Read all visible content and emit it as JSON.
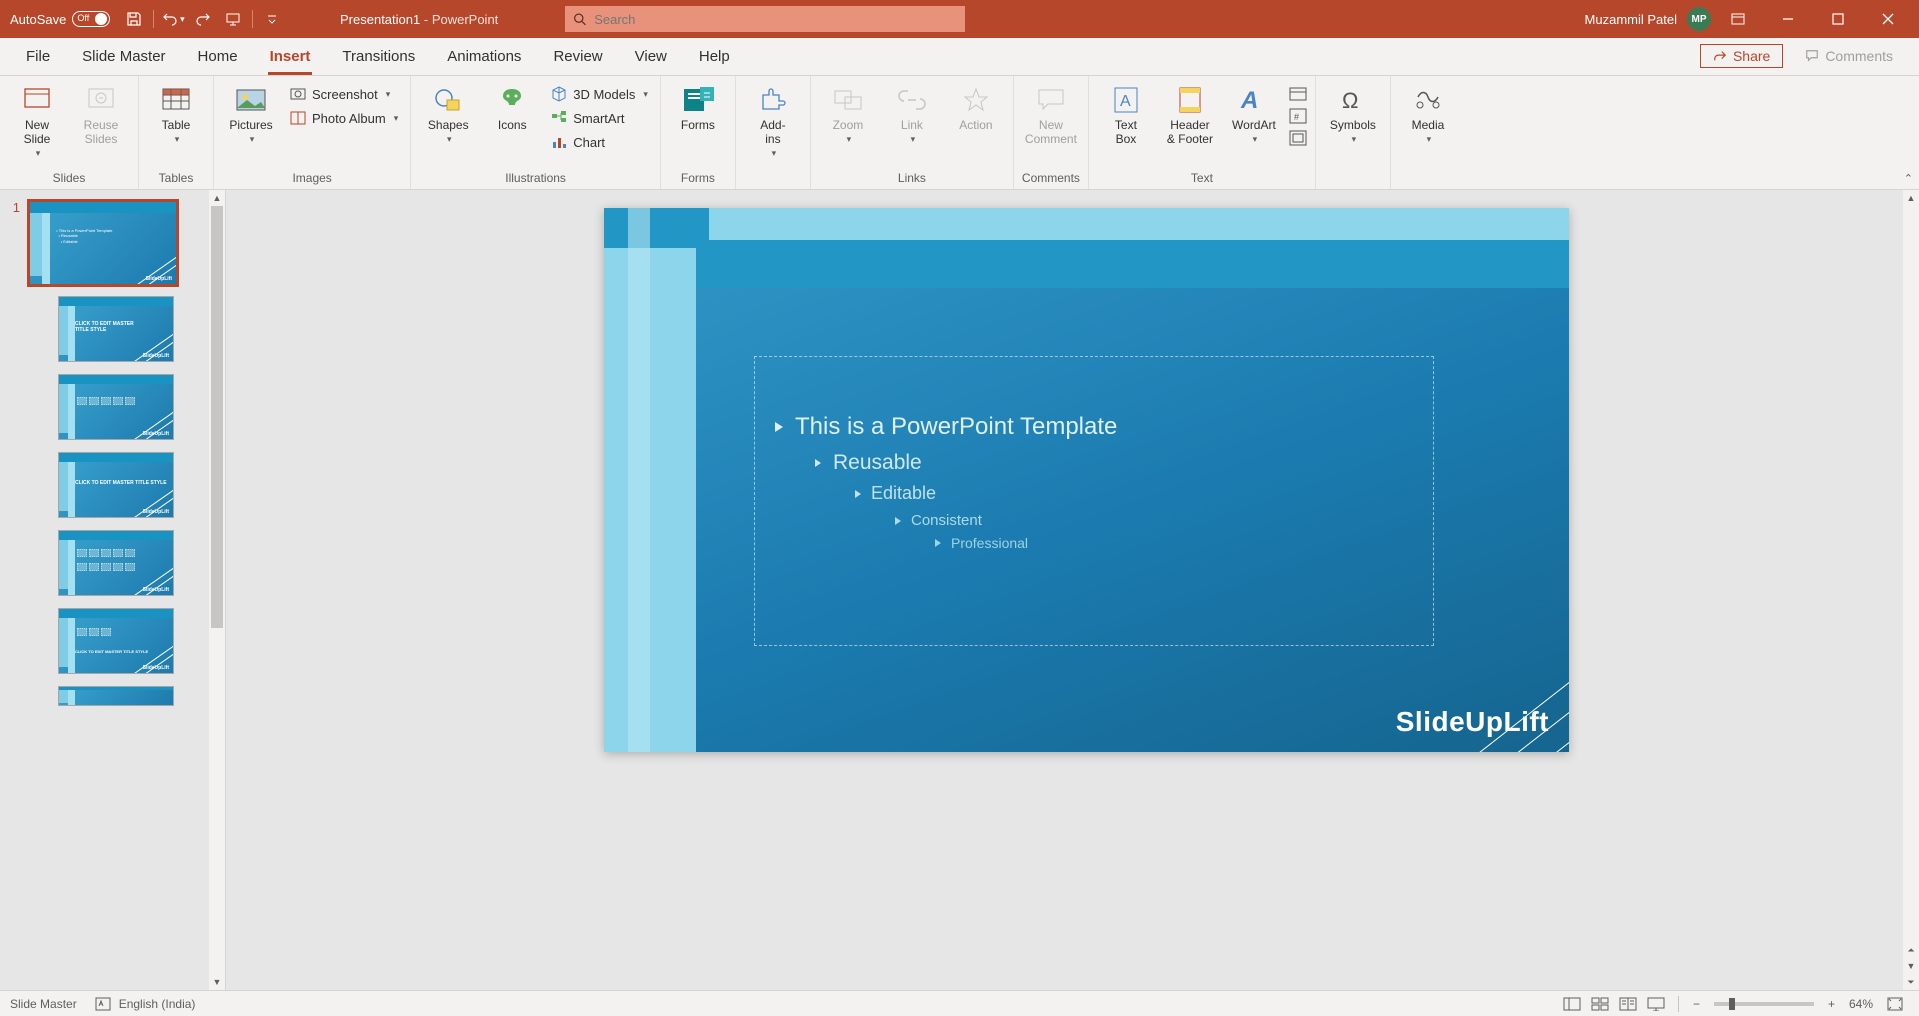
{
  "titlebar": {
    "autosave_label": "AutoSave",
    "autosave_state": "Off",
    "doc_name": "Presentation1",
    "app_name": "PowerPoint",
    "search_placeholder": "Search",
    "user_name": "Muzammil Patel",
    "user_initials": "MP"
  },
  "tabs": {
    "file": "File",
    "slide_master": "Slide Master",
    "home": "Home",
    "insert": "Insert",
    "transitions": "Transitions",
    "animations": "Animations",
    "review": "Review",
    "view": "View",
    "help": "Help",
    "share": "Share",
    "comments": "Comments"
  },
  "ribbon": {
    "slides": {
      "new_slide": "New\nSlide",
      "reuse_slides": "Reuse\nSlides",
      "group": "Slides"
    },
    "tables": {
      "table": "Table",
      "group": "Tables"
    },
    "images": {
      "pictures": "Pictures",
      "screenshot": "Screenshot",
      "photo_album": "Photo Album",
      "group": "Images"
    },
    "illustrations": {
      "shapes": "Shapes",
      "icons": "Icons",
      "models": "3D Models",
      "smartart": "SmartArt",
      "chart": "Chart",
      "group": "Illustrations"
    },
    "forms": {
      "forms": "Forms",
      "group": "Forms"
    },
    "addins": {
      "addins": "Add-\nins",
      "group": ""
    },
    "links": {
      "zoom": "Zoom",
      "link": "Link",
      "action": "Action",
      "group": "Links"
    },
    "comments": {
      "new_comment": "New\nComment",
      "group": "Comments"
    },
    "text": {
      "text_box": "Text\nBox",
      "header_footer": "Header\n& Footer",
      "wordart": "WordArt",
      "group": "Text"
    },
    "symbols": {
      "symbols": "Symbols",
      "group": ""
    },
    "media": {
      "media": "Media",
      "group": ""
    }
  },
  "slide_content": {
    "l1": "This is a PowerPoint Template",
    "l2": "Reusable",
    "l3": "Editable",
    "l4": "Consistent",
    "l5": "Professional",
    "watermark": "SlideUpLift"
  },
  "thumbs": {
    "master_num": "1",
    "mini_title": "CLICK TO EDIT MASTER\nTITLE STYLE",
    "mini_title2": "CLICK TO EDIT MASTER TITLE STYLE"
  },
  "statusbar": {
    "mode": "Slide Master",
    "language": "English (India)",
    "zoom": "64%"
  }
}
